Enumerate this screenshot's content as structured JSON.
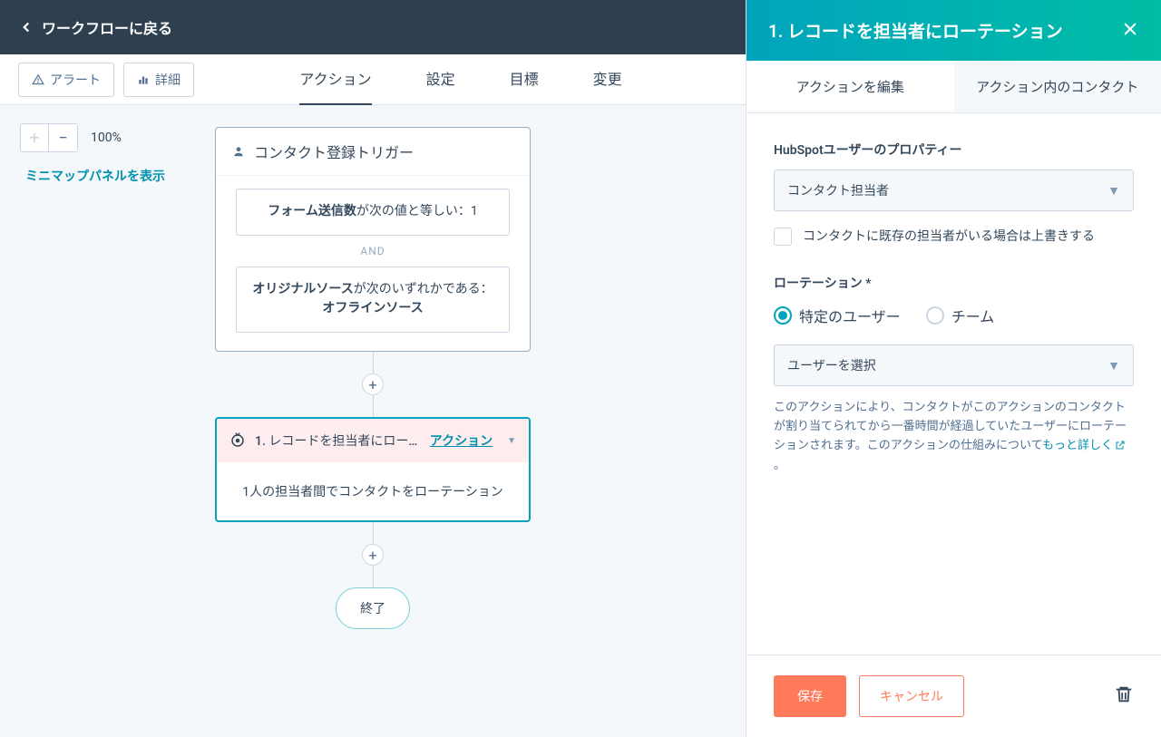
{
  "header": {
    "back_label": "ワークフローに戻る"
  },
  "subnav": {
    "alert": "アラート",
    "details": "詳細",
    "tabs": [
      "アクション",
      "設定",
      "目標",
      "変更"
    ],
    "active_tab": 0
  },
  "canvas": {
    "zoom_pct": "100%",
    "minimap_link": "ミニマップパネルを表示",
    "trigger": {
      "title": "コンタクト登録トリガー",
      "filters": [
        {
          "bold": "フォーム送信数",
          "rest": "が次の値と等しい：1"
        },
        {
          "bold": "オリジナルソース",
          "rest": "が次のいずれかである：",
          "bold2": "オフラインソース"
        }
      ],
      "and_label": "AND"
    },
    "action": {
      "title": "1. レコードを担当者にローテー...",
      "action_link": "アクション",
      "body": "1人の担当者間でコンタクトをローテーション"
    },
    "end_label": "終了"
  },
  "panel": {
    "title": "1. レコードを担当者にローテーション",
    "tabs": [
      "アクションを編集",
      "アクション内のコンタクト"
    ],
    "active_tab": 0,
    "property_label": "HubSpotユーザーのプロパティー",
    "property_value": "コンタクト担当者",
    "overwrite_label": "コンタクトに既存の担当者がいる場合は上書きする",
    "rotation_label": "ローテーション *",
    "radio_users": "特定のユーザー",
    "radio_teams": "チーム",
    "user_select_placeholder": "ユーザーを選択",
    "helper_text": "このアクションにより、コンタクトがこのアクションのコンタクトが割り当てられてから一番時間が経過していたユーザーにローテーションされます。このアクションの仕組みについて",
    "helper_link": "もっと詳しく",
    "helper_period": "。",
    "save": "保存",
    "cancel": "キャンセル"
  }
}
